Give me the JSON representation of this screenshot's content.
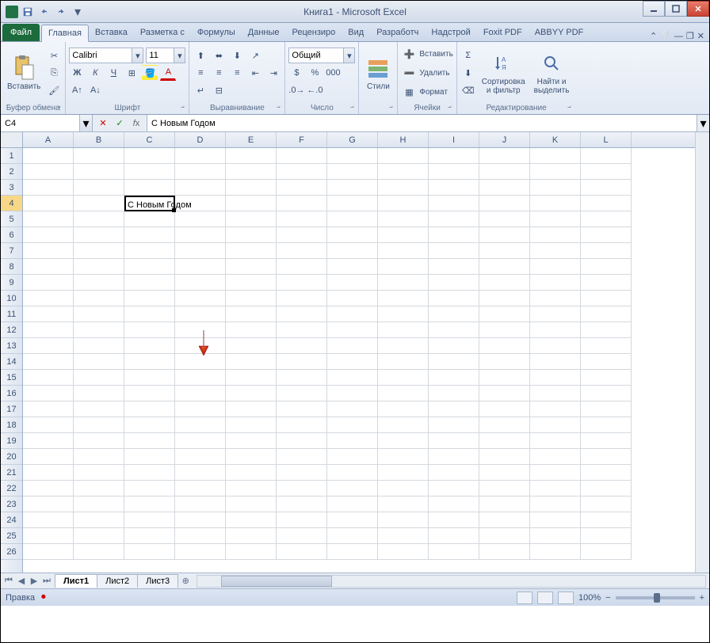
{
  "title": "Книга1 - Microsoft Excel",
  "tabs": {
    "file": "Файл",
    "list": [
      "Главная",
      "Вставка",
      "Разметка с",
      "Формулы",
      "Данные",
      "Рецензиро",
      "Вид",
      "Разработч",
      "Надстрой",
      "Foxit PDF",
      "ABBYY PDF"
    ],
    "active": 0
  },
  "ribbon": {
    "clipboard": {
      "paste": "Вставить",
      "label": "Буфер обмена"
    },
    "font": {
      "name": "Calibri",
      "size": "11",
      "label": "Шрифт"
    },
    "align": {
      "label": "Выравнивание"
    },
    "number": {
      "format": "Общий",
      "label": "Число"
    },
    "styles": {
      "btn": "Стили",
      "label": ""
    },
    "cells": {
      "insert": "Вставить",
      "delete": "Удалить",
      "format": "Формат",
      "label": "Ячейки"
    },
    "editing": {
      "sort": "Сортировка\nи фильтр",
      "find": "Найти и\nвыделить",
      "label": "Редактирование"
    }
  },
  "namebox": "C4",
  "formula": "С Новым Годом",
  "columns": [
    "A",
    "B",
    "C",
    "D",
    "E",
    "F",
    "G",
    "H",
    "I",
    "J",
    "K",
    "L"
  ],
  "rows": [
    "1",
    "2",
    "3",
    "4",
    "5",
    "6",
    "7",
    "8",
    "9",
    "10",
    "11",
    "12",
    "13",
    "14",
    "15",
    "16",
    "17",
    "18",
    "19",
    "20",
    "21",
    "22",
    "23",
    "24",
    "25",
    "26"
  ],
  "active_cell": {
    "row": 4,
    "col": "C",
    "value": "С Новым Годом"
  },
  "sheets": {
    "list": [
      "Лист1",
      "Лист2",
      "Лист3"
    ],
    "active": 0
  },
  "status": {
    "mode": "Правка",
    "zoom": "100%"
  }
}
